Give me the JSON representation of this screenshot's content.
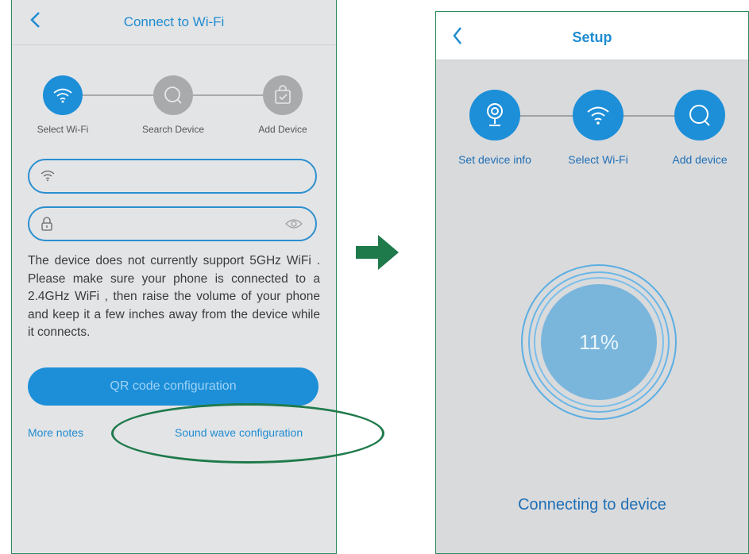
{
  "left_screen": {
    "title": "Connect to Wi-Fi",
    "steps": [
      {
        "label": "Select Wi-Fi",
        "icon": "wifi-icon",
        "active": true
      },
      {
        "label": "Search Device",
        "icon": "search-icon",
        "active": false
      },
      {
        "label": "Add Device",
        "icon": "check-bag-icon",
        "active": false
      }
    ],
    "wifi_field": {
      "value": "",
      "placeholder": ""
    },
    "password_field": {
      "value": "",
      "placeholder": ""
    },
    "notice": "The device does not currently support 5GHz WiFi . Please make sure your phone is connected to a 2.4GHz WiFi , then raise the volume of your phone and keep it a few inches away from the device while it connects.",
    "qr_button": "QR code configuration",
    "more_notes": "More notes",
    "sound_wave": "Sound wave configuration"
  },
  "right_screen": {
    "title": "Setup",
    "steps": [
      {
        "label": "Set device info",
        "icon": "camera-icon"
      },
      {
        "label": "Select Wi-Fi",
        "icon": "wifi-icon"
      },
      {
        "label": "Add device",
        "icon": "search-icon"
      }
    ],
    "progress": {
      "percent_label": "11%",
      "value": 11
    },
    "status": "Connecting to device"
  },
  "colors": {
    "accent": "#1d8fd8",
    "annotation": "#1f7a4b",
    "left_bg": "#e3e4e6",
    "right_bg": "#d9dadc"
  }
}
